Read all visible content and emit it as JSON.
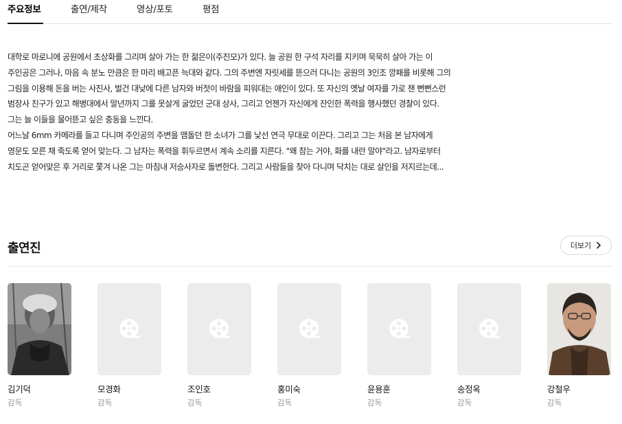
{
  "tabs": [
    {
      "label": "주요정보",
      "active": true
    },
    {
      "label": "출연/제작",
      "active": false
    },
    {
      "label": "영상/포토",
      "active": false
    },
    {
      "label": "평점",
      "active": false
    }
  ],
  "synopsis": {
    "paragraphs": [
      "대학로 마로니에 공원에서 초상화를 그리며 살아 가는 한 젊은이(주진모)가 있다. 늘 공원 한 구석 자리를 지키며 묵묵히 살아 가는 이 주인공은 그러나, 마음 속 분노 만큼은 한 마리 배고픈 늑대와 같다. 그의 주변엔 자릿세를 뜯으러 다니는 공원의 3인조 깡패를 비롯해 그의 그림을 이용해 돈을 버는 사진사, 벌건 대낮에 다른 남자와 버젓이 바람을 피워대는 애인이 있다. 또 자신의 옛날 여자를 가로 챈 뻔뻔스런 범장사 친구가 있고 해병대에서 말년까지 그를 못살게 굴었던 군대 상사, 그리고 언젠가 자신에게 잔인한 폭력을 행사했던 경찰이 있다. 그는 늘 이들을 물어뜯고 싶은 충동을 느낀다.",
      "어느날 6mm 카메라를 들고 다니며 주인공의 주변을 맴돌던 한 소녀가 그를 낯선 연극 무대로 이끈다. 그리고 그는 처음 본 남자에게 영문도 모른 채 죽도록 얻어 맞는다. 그 남자는 폭력을 휘두르면서 계속 소리를 지른다. \"왜 참는 거야, 화를 내란 말야\"라고. 남자로부터 치도곤 얻어맞은 후 거리로 쫓겨 나온 그는 마침내 저승사자로 돌변한다. 그리고 사람들을 찾아 다니며 닥치는 대로 살인을 저지르는데..."
    ]
  },
  "cast_section": {
    "title": "출연진",
    "more_label": "더보기",
    "more_icon": "chevron-right-icon",
    "members": [
      {
        "name": "김기덕",
        "role": "감독",
        "photo": "portrait"
      },
      {
        "name": "모경화",
        "role": "감독",
        "photo": "placeholder-film-reel-icon"
      },
      {
        "name": "조인호",
        "role": "감독",
        "photo": "placeholder-film-reel-icon"
      },
      {
        "name": "홍미숙",
        "role": "감독",
        "photo": "placeholder-film-reel-icon"
      },
      {
        "name": "윤용훈",
        "role": "감독",
        "photo": "placeholder-film-reel-icon"
      },
      {
        "name": "송정옥",
        "role": "감독",
        "photo": "placeholder-film-reel-icon"
      },
      {
        "name": "강철우",
        "role": "감독",
        "photo": "portrait"
      }
    ]
  },
  "colors": {
    "text_primary": "#111111",
    "text_secondary": "#999999",
    "divider": "#e4e4e4",
    "placeholder_bg": "#ececec"
  }
}
